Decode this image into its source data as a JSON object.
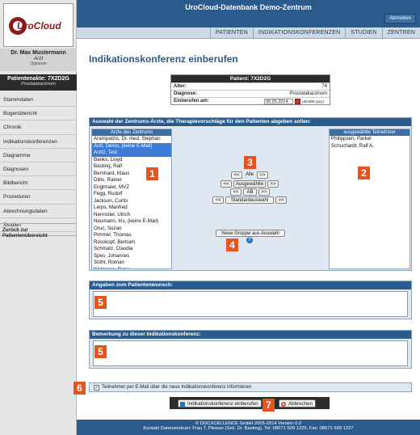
{
  "app": {
    "title": "UroCloud-Datenbank Demo-Zentrum",
    "logout": "Abmelden"
  },
  "logo": {
    "text": "UroCloud"
  },
  "nav": {
    "tabs": [
      "PATIENTEN",
      "INDIKATIONSKONFERENZEN",
      "STUDIEN",
      "ZENTREN"
    ]
  },
  "user": {
    "name": "Dr. Max Mustermann",
    "role": "Arzt",
    "options": "Optionen"
  },
  "patient_card": {
    "title": "Patientenakte: 7X2D2G",
    "diagnosis": "Prostatakarzinom"
  },
  "sidebar": {
    "items": [
      "Stammdaten",
      "Bogenübericht",
      "Chronik",
      "Indikationskonferenzen",
      "Diagramme",
      "Diagnosen",
      "Bildbericht",
      "Prozeduren",
      "Abrechnungsdaten",
      "Studien"
    ],
    "back": "Zurück zur Patientenübersicht"
  },
  "page": {
    "title": "Indikationskonferenz einberufen"
  },
  "patient_info": {
    "header": "Patient: 7X2D2G",
    "age_label": "Alter:",
    "age": "74",
    "diag_label": "Diagnose:",
    "diag": "Prostatakarzinom",
    "date_label": "Einberufen am:",
    "date": "05.05.2014",
    "date_fmt": "(dd.MM.yyyy)"
  },
  "selection": {
    "header": "Auswahl der Zentrums-Ärzte, die Therapievorschläge für den Patienten abgeben sollen:",
    "left_header": "Ärzte des Zentrums",
    "right_header": "ausgewählte Teilnehmer",
    "doctors": [
      {
        "name": "Arampatzis, Dr. med. Stephan",
        "selected": false
      },
      {
        "name": "Arzt, Demo, (keine E-Mail)",
        "selected": true
      },
      {
        "name": "Arzt2, Test",
        "selected": true
      },
      {
        "name": "Banks, Lloyd",
        "selected": false
      },
      {
        "name": "Basting, Ralf",
        "selected": false
      },
      {
        "name": "Bernhard, Klaus",
        "selected": false
      },
      {
        "name": "Dillis, Rainer",
        "selected": false
      },
      {
        "name": "Englmaier, MVZ",
        "selected": false
      },
      {
        "name": "Fegg, Rudolf",
        "selected": false
      },
      {
        "name": "Jackson, Curtis",
        "selected": false
      },
      {
        "name": "Lerps, Manfred",
        "selected": false
      },
      {
        "name": "Nennstiel, Ulrich",
        "selected": false
      },
      {
        "name": "Neumann, Iris, (keine E-Mail)",
        "selected": false
      },
      {
        "name": "Oruc, Suzan",
        "selected": false
      },
      {
        "name": "Pimmer, Thomas",
        "selected": false
      },
      {
        "name": "Rosskopf, Bertram",
        "selected": false
      },
      {
        "name": "Schmatz, Claudia",
        "selected": false
      },
      {
        "name": "Spes, Johannes",
        "selected": false
      },
      {
        "name": "Stöhr, Roman",
        "selected": false
      },
      {
        "name": "Widmann, Peter",
        "selected": false
      }
    ],
    "participants": [
      "Philippsen, Parker",
      "Schuchardt, Ralf A."
    ],
    "btn_all_left": "<<",
    "btn_all": "Alle",
    "btn_all_right": ">>",
    "btn_sel_left": "<<",
    "btn_sel": "Ausgewählte",
    "btn_sel_right": ">>",
    "btn_ab_left": "<<",
    "btn_ab": "AB",
    "btn_ab_right": ">>",
    "btn_std_left": "<<",
    "btn_std": "Standardauswahl",
    "btn_std_right": ">>",
    "btn_group": "Neue Gruppe aus Auswahl",
    "help": "?"
  },
  "markers": [
    "1",
    "2",
    "3",
    "4",
    "5",
    "5",
    "6",
    "7"
  ],
  "wish_panel": {
    "header": "Angaben zum Patientenwunsch:"
  },
  "remark_panel": {
    "header": "Bemerkung zu dieser Indikationskonferenz:"
  },
  "notify": {
    "label": "Teilnehmer per E-Mail über die neue Indikationskonferenz informieren",
    "checked": "✓"
  },
  "actions": {
    "submit": "Indikationskonferenz einberufen",
    "cancel": "Abbrechen"
  },
  "footer": {
    "line1": "© DOCXCELLENCE GmbH 2005-2014          Version 0.0",
    "line2": "Kontakt Datenzentrum:   Frau T. Plewan (Sek. Dr. Basting),   Tel: 08671 509 1225,   Fax: 08671 509 1227"
  },
  "colors": {
    "header": "#2b5a8c",
    "marker": "#e8541e",
    "selected": "#3b7bd6",
    "dark": "#2b2b2b"
  }
}
